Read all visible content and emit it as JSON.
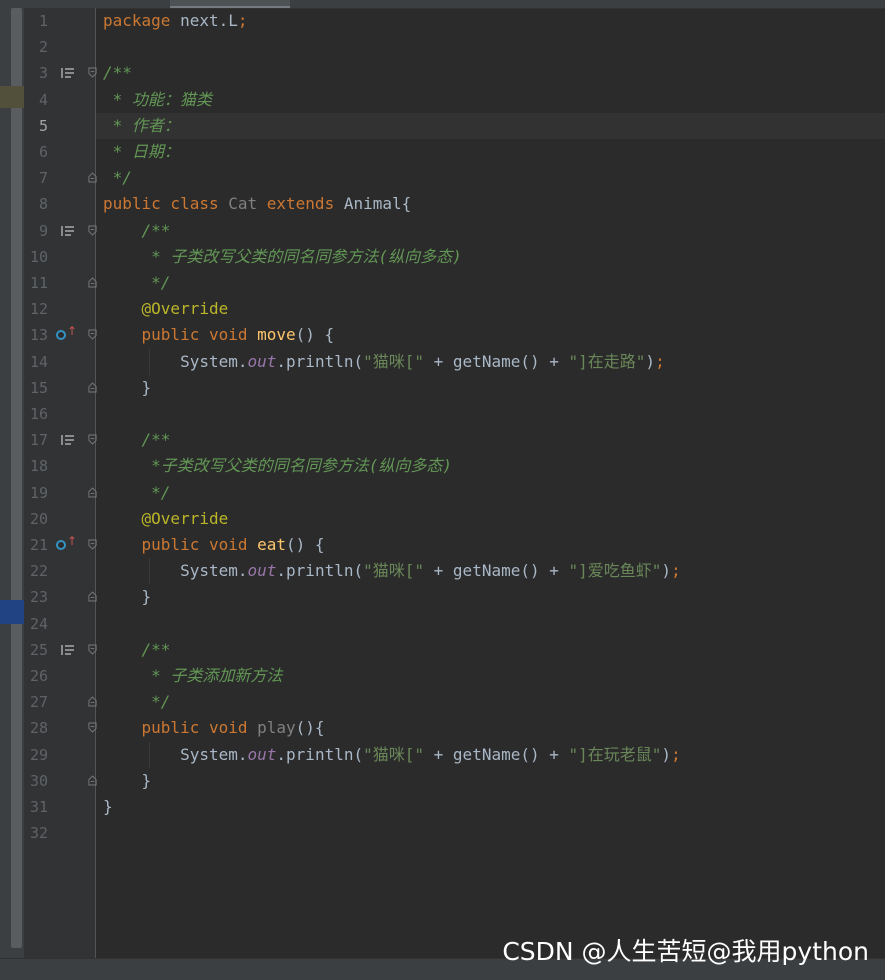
{
  "editor": {
    "current_line": 5,
    "lines": [
      {
        "n": "1",
        "icon": "",
        "fold": "",
        "tokens": [
          {
            "t": "package ",
            "c": "kw"
          },
          {
            "t": "next.L",
            "c": "plain"
          },
          {
            "t": ";",
            "c": "kw"
          }
        ]
      },
      {
        "n": "2",
        "icon": "",
        "fold": "",
        "tokens": []
      },
      {
        "n": "3",
        "icon": "doc",
        "fold": "open",
        "tokens": [
          {
            "t": "/**",
            "c": "cm"
          }
        ]
      },
      {
        "n": "4",
        "icon": "",
        "fold": "",
        "tokens": [
          {
            "t": " * 功能：猫类",
            "c": "cm"
          }
        ]
      },
      {
        "n": "5",
        "icon": "",
        "fold": "",
        "tokens": [
          {
            "t": " * 作者：",
            "c": "cm"
          }
        ]
      },
      {
        "n": "6",
        "icon": "",
        "fold": "",
        "tokens": [
          {
            "t": " * 日期：",
            "c": "cm"
          }
        ]
      },
      {
        "n": "7",
        "icon": "",
        "fold": "close",
        "tokens": [
          {
            "t": " */",
            "c": "cm"
          }
        ]
      },
      {
        "n": "8",
        "icon": "",
        "fold": "",
        "tokens": [
          {
            "t": "public class ",
            "c": "kw"
          },
          {
            "t": "Cat ",
            "c": "gray"
          },
          {
            "t": "extends ",
            "c": "kw"
          },
          {
            "t": "Animal{",
            "c": "plain"
          }
        ]
      },
      {
        "n": "9",
        "icon": "doc",
        "fold": "open",
        "tokens": [
          {
            "t": "    ",
            "c": "plain"
          },
          {
            "t": "/**",
            "c": "cm"
          }
        ]
      },
      {
        "n": "10",
        "icon": "",
        "fold": "",
        "tokens": [
          {
            "t": "     * 子类改写父类的同名同参方法(纵向多态)",
            "c": "cm"
          }
        ]
      },
      {
        "n": "11",
        "icon": "",
        "fold": "close",
        "tokens": [
          {
            "t": "     */",
            "c": "cm"
          }
        ]
      },
      {
        "n": "12",
        "icon": "",
        "fold": "",
        "tokens": [
          {
            "t": "    ",
            "c": "plain"
          },
          {
            "t": "@Override",
            "c": "an"
          }
        ]
      },
      {
        "n": "13",
        "icon": "override",
        "fold": "open",
        "tokens": [
          {
            "t": "    ",
            "c": "plain"
          },
          {
            "t": "public void ",
            "c": "kw"
          },
          {
            "t": "move",
            "c": "fn"
          },
          {
            "t": "() {",
            "c": "plain"
          }
        ]
      },
      {
        "n": "14",
        "icon": "",
        "fold": "",
        "tokens": [
          {
            "t": "        System.",
            "c": "plain"
          },
          {
            "t": "out",
            "c": "fd"
          },
          {
            "t": ".println(",
            "c": "plain"
          },
          {
            "t": "\"猫咪[\" ",
            "c": "st"
          },
          {
            "t": "+ getName() + ",
            "c": "plain"
          },
          {
            "t": "\"]在走路\"",
            "c": "st"
          },
          {
            "t": ")",
            "c": "plain"
          },
          {
            "t": ";",
            "c": "kw"
          }
        ]
      },
      {
        "n": "15",
        "icon": "",
        "fold": "close",
        "tokens": [
          {
            "t": "    }",
            "c": "plain"
          }
        ]
      },
      {
        "n": "16",
        "icon": "",
        "fold": "",
        "tokens": []
      },
      {
        "n": "17",
        "icon": "doc",
        "fold": "open",
        "tokens": [
          {
            "t": "    ",
            "c": "plain"
          },
          {
            "t": "/**",
            "c": "cm"
          }
        ]
      },
      {
        "n": "18",
        "icon": "",
        "fold": "",
        "tokens": [
          {
            "t": "     *子类改写父类的同名同参方法(纵向多态)",
            "c": "cm"
          }
        ]
      },
      {
        "n": "19",
        "icon": "",
        "fold": "close",
        "tokens": [
          {
            "t": "     */",
            "c": "cm"
          }
        ]
      },
      {
        "n": "20",
        "icon": "",
        "fold": "",
        "tokens": [
          {
            "t": "    ",
            "c": "plain"
          },
          {
            "t": "@Override",
            "c": "an"
          }
        ]
      },
      {
        "n": "21",
        "icon": "override",
        "fold": "open",
        "tokens": [
          {
            "t": "    ",
            "c": "plain"
          },
          {
            "t": "public void ",
            "c": "kw"
          },
          {
            "t": "eat",
            "c": "fn"
          },
          {
            "t": "() {",
            "c": "plain"
          }
        ]
      },
      {
        "n": "22",
        "icon": "",
        "fold": "",
        "tokens": [
          {
            "t": "        System.",
            "c": "plain"
          },
          {
            "t": "out",
            "c": "fd"
          },
          {
            "t": ".println(",
            "c": "plain"
          },
          {
            "t": "\"猫咪[\" ",
            "c": "st"
          },
          {
            "t": "+ getName() + ",
            "c": "plain"
          },
          {
            "t": "\"]爱吃鱼虾\"",
            "c": "st"
          },
          {
            "t": ")",
            "c": "plain"
          },
          {
            "t": ";",
            "c": "kw"
          }
        ]
      },
      {
        "n": "23",
        "icon": "",
        "fold": "close",
        "tokens": [
          {
            "t": "    }",
            "c": "plain"
          }
        ]
      },
      {
        "n": "24",
        "icon": "",
        "fold": "",
        "tokens": []
      },
      {
        "n": "25",
        "icon": "doc",
        "fold": "open",
        "tokens": [
          {
            "t": "    ",
            "c": "plain"
          },
          {
            "t": "/**",
            "c": "cm"
          }
        ]
      },
      {
        "n": "26",
        "icon": "",
        "fold": "",
        "tokens": [
          {
            "t": "     * 子类添加新方法",
            "c": "cm"
          }
        ]
      },
      {
        "n": "27",
        "icon": "",
        "fold": "close",
        "tokens": [
          {
            "t": "     */",
            "c": "cm"
          }
        ]
      },
      {
        "n": "28",
        "icon": "",
        "fold": "open",
        "tokens": [
          {
            "t": "    ",
            "c": "plain"
          },
          {
            "t": "public void ",
            "c": "kw"
          },
          {
            "t": "play",
            "c": "gray"
          },
          {
            "t": "(){",
            "c": "plain"
          }
        ]
      },
      {
        "n": "29",
        "icon": "",
        "fold": "",
        "tokens": [
          {
            "t": "        System.",
            "c": "plain"
          },
          {
            "t": "out",
            "c": "fd"
          },
          {
            "t": ".println(",
            "c": "plain"
          },
          {
            "t": "\"猫咪[\" ",
            "c": "st"
          },
          {
            "t": "+ getName() + ",
            "c": "plain"
          },
          {
            "t": "\"]在玩老鼠\"",
            "c": "st"
          },
          {
            "t": ")",
            "c": "plain"
          },
          {
            "t": ";",
            "c": "kw"
          }
        ]
      },
      {
        "n": "30",
        "icon": "",
        "fold": "close",
        "tokens": [
          {
            "t": "    }",
            "c": "plain"
          }
        ]
      },
      {
        "n": "31",
        "icon": "",
        "fold": "",
        "tokens": [
          {
            "t": "}",
            "c": "plain"
          }
        ]
      },
      {
        "n": "32",
        "icon": "",
        "fold": "",
        "tokens": []
      }
    ]
  },
  "colors": {
    "background": "#2b2b2b",
    "keyword": "#cc7832",
    "comment": "#629755",
    "annotation": "#bbb529",
    "method": "#ffc66d",
    "string": "#6a8759",
    "field": "#9876aa",
    "text": "#a9b7c6"
  },
  "watermark": {
    "text": "CSDN @人生苦短@我用python"
  }
}
